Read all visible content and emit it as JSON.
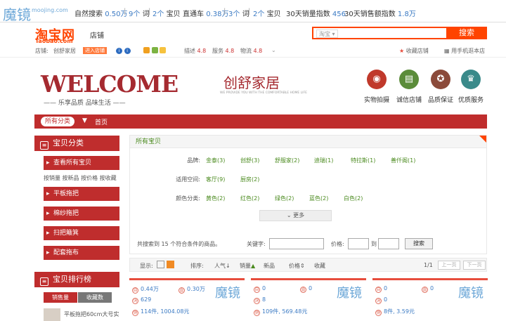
{
  "stats_bar": {
    "logo": "魔镜",
    "logo_url": "moojing.com",
    "natural_search_label": "自然搜索",
    "natural_search_value": "0.50万",
    "words_count": "9个",
    "words_unit": "词",
    "items_count": "2个",
    "items_unit": "宝贝",
    "ztc_label": "直通车",
    "ztc_value": "0.38万",
    "ztc_words_count": "3个",
    "ztc_words_unit": "词",
    "ztc_items_count": "2个",
    "ztc_items_unit": "宝贝",
    "sales_index_label": "30天销量指数",
    "sales_index_value": "456",
    "revenue_index_label": "30天销售额指数",
    "revenue_index_value": "1.8万"
  },
  "header": {
    "taobao_logo": "淘宝网",
    "taobao_url": "Taobao.com",
    "shop_tab": "店铺",
    "search_select": "淘宝",
    "search_button": "搜索",
    "shop_label": "店铺:",
    "shop_name": "创舒家居",
    "enter_shop": "进入店铺",
    "desc_label": "描述",
    "desc_value": "4.8",
    "service_label": "服务",
    "service_value": "4.8",
    "logistics_label": "物流",
    "logistics_value": "4.8",
    "favorite": "收藏店铺",
    "mobile": "用手机逛本店"
  },
  "banner": {
    "welcome": "WELCOME",
    "slogan": "乐享品质  品味生活",
    "brand": "创舒家居",
    "brand_sub": "WE PROVIDE YOU WITH THE COMFORTABLE HOME LIFE",
    "features": [
      {
        "label": "实物拍摄",
        "color": "#c0392b",
        "icon": "camera-icon",
        "glyph": "◉"
      },
      {
        "label": "诚信店铺",
        "color": "#5b8c3a",
        "icon": "book-icon",
        "glyph": "▤"
      },
      {
        "label": "品质保证",
        "color": "#8b4a3a",
        "icon": "medal-icon",
        "glyph": "✪"
      },
      {
        "label": "优质服务",
        "color": "#3a8a8a",
        "icon": "trophy-icon",
        "glyph": "♛"
      }
    ]
  },
  "nav": {
    "all_categories": "所有分类",
    "home": "首页"
  },
  "sidebar": {
    "title": "宝贝分类",
    "items": [
      "查看所有宝贝",
      "平板拖把",
      "棉纱拖把",
      "扫把簸箕",
      "配套拖布"
    ],
    "sub_links": "按销量 按新品 按价格 按收藏"
  },
  "ranking": {
    "title": "宝贝排行榜",
    "tab_sales": "销售量",
    "tab_fav": "收藏数",
    "first_item": "平板拖把60cm大号实"
  },
  "filter": {
    "title": "所有宝贝",
    "brand_label": "品牌:",
    "brands": [
      "金泰(3)",
      "创舒(3)",
      "舒服家(2)",
      "迪瑞(1)",
      "特拉斯(1)",
      "善仟阁(1)"
    ],
    "space_label": "适用空间:",
    "spaces": [
      "客厅(9)",
      "厨房(2)"
    ],
    "color_label": "颜色分类:",
    "colors": [
      "黄色(2)",
      "红色(2)",
      "绿色(2)",
      "蓝色(2)",
      "白色(2)"
    ],
    "more": "更多",
    "result_prefix": "共搜索到",
    "result_count": "15",
    "result_suffix": "个符合条件的商品。",
    "keyword_label": "关键字:",
    "price_label": "价格:",
    "to": "到",
    "search_button": "搜索"
  },
  "sortbar": {
    "display_label": "显示:",
    "sort_label": "排序:",
    "popularity": "人气↓",
    "sales": "销量",
    "newest": "新品",
    "price": "价格",
    "favorites": "收藏",
    "page_info": "1/1",
    "prev": "上一页",
    "next": "下一页"
  },
  "cards": [
    {
      "natural": "0.44万",
      "ztc": "0.30万",
      "words": "629",
      "sales": "114件, 1004.08元",
      "logo": "魔镜"
    },
    {
      "natural": "0",
      "ztc": "0",
      "words": "8",
      "sales": "109件, 569.48元",
      "logo": "魔镜"
    },
    {
      "natural": "0",
      "ztc": "0",
      "words": "0",
      "sales": "8件, 3.59元",
      "logo": "魔镜"
    }
  ]
}
